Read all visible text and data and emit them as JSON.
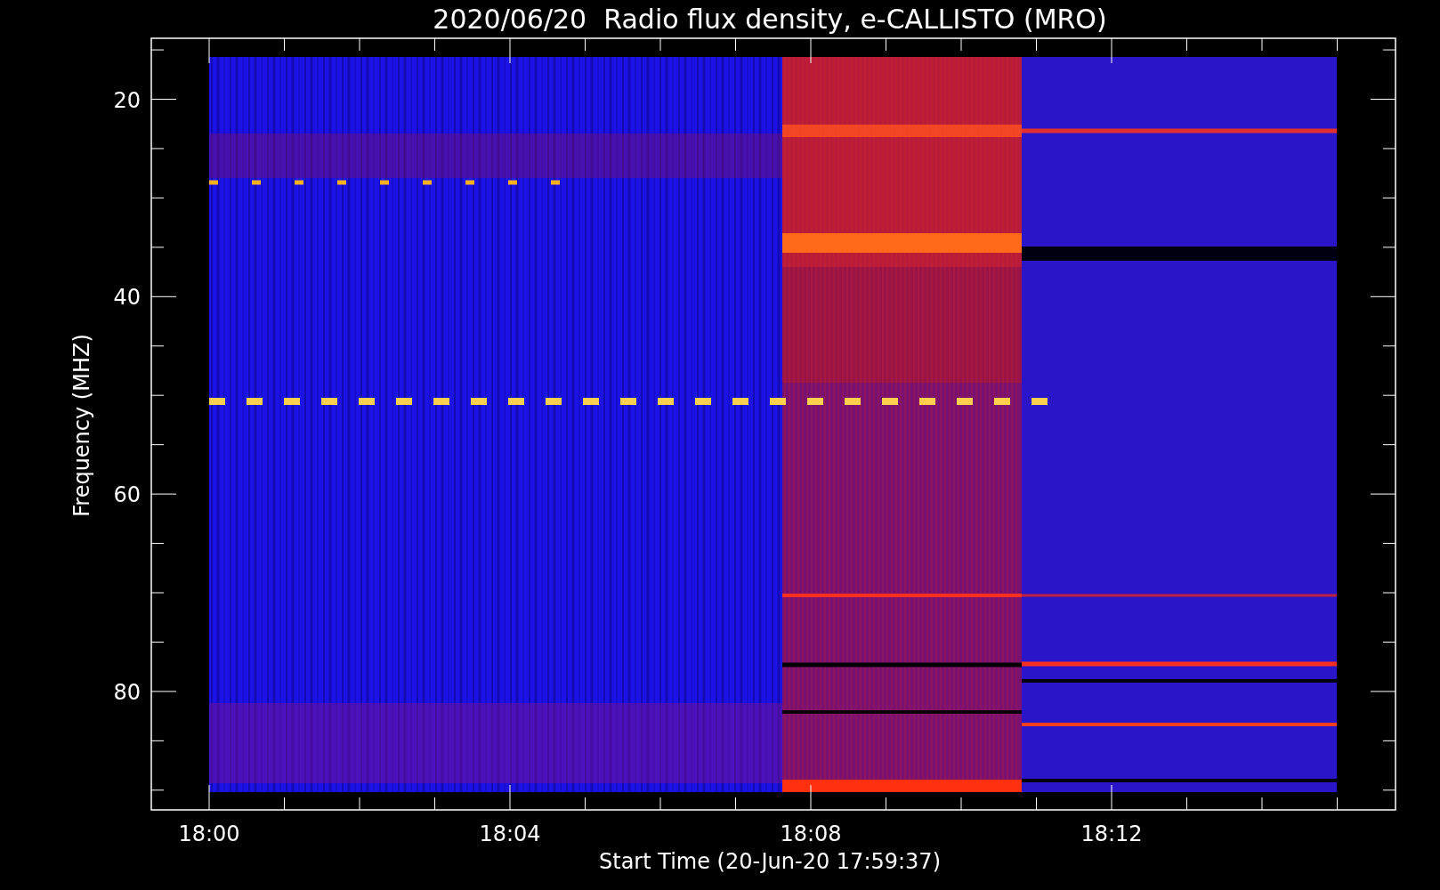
{
  "title": "2020/06/20  Radio flux density, e-CALLISTO (MRO)",
  "y_axis": {
    "label": "Frequency (MHZ)",
    "ticks": [
      "20",
      "40",
      "60",
      "80"
    ]
  },
  "x_axis": {
    "label": "Start Time (20-Jun-20 17:59:37)",
    "ticks": [
      "18:00",
      "18:04",
      "18:08",
      "18:12"
    ]
  }
}
